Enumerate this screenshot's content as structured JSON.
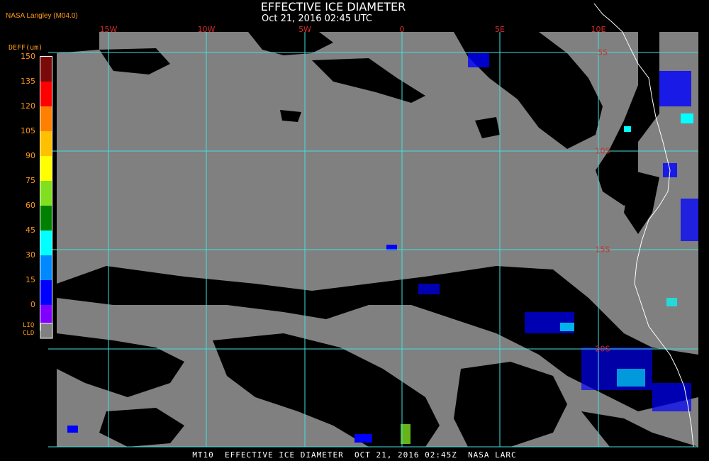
{
  "header": {
    "title": "EFFECTIVE ICE DIAMETER",
    "subtitle": "Oct 21, 2016 02:45 UTC",
    "credit": "NASA Langley (M04.0)"
  },
  "footer": {
    "caption": "MT10  EFFECTIVE ICE DIAMETER  OCT 21, 2016 02:45Z  NASA LARC"
  },
  "legend": {
    "title": "DEFF(um)",
    "ticks": [
      "150",
      "135",
      "120",
      "105",
      "90",
      "75",
      "60",
      "45",
      "30",
      "15",
      "0"
    ],
    "colors": [
      "#7a0a0a",
      "#ff0000",
      "#ff8000",
      "#ffc000",
      "#ffff00",
      "#80e020",
      "#008000",
      "#00ffff",
      "#0088ff",
      "#0000ff",
      "#8000ff"
    ],
    "liquid_label_line1": "LIQ",
    "liquid_label_line2": "CLD",
    "liquid_color": "#808080"
  },
  "grid": {
    "color": "#40e0e0",
    "longitude_labels": [
      "15W",
      "10W",
      "5W",
      "0",
      "5E",
      "10E"
    ],
    "latitude_labels": [
      "5S",
      "10S",
      "15S",
      "20S"
    ]
  },
  "map": {
    "liquid_cloud_color": "#808080",
    "clear_color": "#000000",
    "coastline_color": "#ffffff"
  }
}
